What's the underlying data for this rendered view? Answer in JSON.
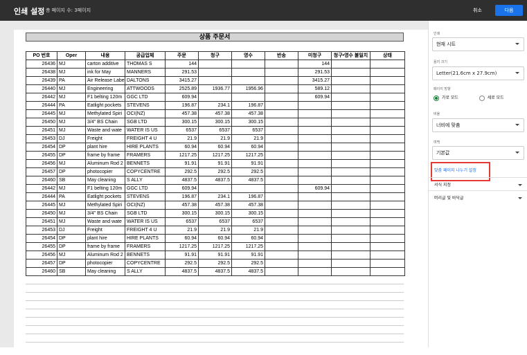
{
  "topbar": {
    "title": "인쇄 설정",
    "pages": "총 페이지 수: 3페이지",
    "cancel": "취소",
    "next": "다음"
  },
  "sheet": {
    "title": "상품 주문서",
    "headers": [
      "PO 번호",
      "Oper",
      "내용",
      "공급업체",
      "주문",
      "청구",
      "영수",
      "반송",
      "미청구",
      "청구•영수 불일치",
      "상태"
    ],
    "rows": [
      [
        "26436",
        "MJ",
        "carton additive",
        "THOMAS S",
        "144",
        "",
        "",
        "",
        "144",
        "",
        ""
      ],
      [
        "26438",
        "MJ",
        "ink for May",
        "MANNERS",
        "291.53",
        "",
        "",
        "",
        "291.53",
        "",
        ""
      ],
      [
        "26439",
        "PA",
        "Air Release Labe",
        "DALTONS",
        "3415.27",
        "",
        "",
        "",
        "3415.27",
        "",
        ""
      ],
      [
        "26440",
        "MJ",
        "Engineering",
        "ATTWOODS",
        "2525.89",
        "1936.77",
        "1956.96",
        "",
        "589.12",
        "",
        ""
      ],
      [
        "26442",
        "MJ",
        "F1 belting 120m",
        "GGC LTD",
        "609.94",
        "",
        "",
        "",
        "609.94",
        "",
        ""
      ],
      [
        "26444",
        "PA",
        "Eatlight pockets",
        "STEVENS",
        "196.87",
        "234.1",
        "196.87",
        "",
        "",
        "",
        ""
      ],
      [
        "26445",
        "MJ",
        "Methylated Spiri",
        "OCI(NZ)",
        "457.38",
        "457.38",
        "457.38",
        "",
        "",
        "",
        ""
      ],
      [
        "26450",
        "MJ",
        "3/4\" BS Chain",
        "SGB LTD",
        "300.15",
        "300.15",
        "300.15",
        "",
        "",
        "",
        ""
      ],
      [
        "26451",
        "MJ",
        "Waste and wate",
        "WATER IS US",
        "6537",
        "6537",
        "6537",
        "",
        "",
        "",
        ""
      ],
      [
        "26453",
        "DJ",
        "Freight",
        "FREIGHT 4 U",
        "21.9",
        "21.9",
        "21.9",
        "",
        "",
        "",
        ""
      ],
      [
        "26454",
        "DP",
        "plant hire",
        "HIRE PLANTS",
        "60.94",
        "60.94",
        "60.94",
        "",
        "",
        "",
        ""
      ],
      [
        "26455",
        "DP",
        "frame by frame",
        "FRAMERS",
        "1217.25",
        "1217.25",
        "1217.25",
        "",
        "",
        "",
        ""
      ],
      [
        "26456",
        "MJ",
        "Aluminum Rod 2",
        "BENNETS",
        "91.91",
        "91.91",
        "91.91",
        "",
        "",
        "",
        ""
      ],
      [
        "26457",
        "DP",
        "photocopier",
        "COPYCENTRE",
        "292.5",
        "292.5",
        "292.5",
        "",
        "",
        "",
        ""
      ],
      [
        "26460",
        "SB",
        "May cleaning",
        "S ALLY",
        "4837.5",
        "4837.5",
        "4837.5",
        "",
        "",
        "",
        ""
      ],
      [
        "26442",
        "MJ",
        "F1 belting 120m",
        "GGC LTD",
        "609.94",
        "",
        "",
        "",
        "609.94",
        "",
        ""
      ],
      [
        "26444",
        "PA",
        "Eatlight pockets",
        "STEVENS",
        "196.87",
        "234.1",
        "196.87",
        "",
        "",
        "",
        ""
      ],
      [
        "26445",
        "MJ",
        "Methylated Spiri",
        "OCI(NZ)",
        "457.38",
        "457.38",
        "457.38",
        "",
        "",
        "",
        ""
      ],
      [
        "26450",
        "MJ",
        "3/4\" BS Chain",
        "SGB LTD",
        "300.15",
        "300.15",
        "300.15",
        "",
        "",
        "",
        ""
      ],
      [
        "26451",
        "MJ",
        "Waste and wate",
        "WATER IS US",
        "6537",
        "6537",
        "6537",
        "",
        "",
        "",
        ""
      ],
      [
        "26453",
        "DJ",
        "Freight",
        "FREIGHT 4 U",
        "21.9",
        "21.9",
        "21.9",
        "",
        "",
        "",
        ""
      ],
      [
        "26454",
        "DP",
        "plant hire",
        "HIRE PLANTS",
        "60.94",
        "60.94",
        "60.94",
        "",
        "",
        "",
        ""
      ],
      [
        "26455",
        "DP",
        "frame by frame",
        "FRAMERS",
        "1217.25",
        "1217.25",
        "1217.25",
        "",
        "",
        "",
        ""
      ],
      [
        "26456",
        "MJ",
        "Aluminum Rod 2",
        "BENNETS",
        "91.91",
        "91.91",
        "91.91",
        "",
        "",
        "",
        ""
      ],
      [
        "26457",
        "DP",
        "photocopier",
        "COPYCENTRE",
        "292.5",
        "292.5",
        "292.5",
        "",
        "",
        "",
        ""
      ],
      [
        "26460",
        "SB",
        "May cleaning",
        "S ALLY",
        "4837.5",
        "4837.5",
        "4837.5",
        "",
        "",
        "",
        ""
      ]
    ]
  },
  "panel": {
    "print_label": "인쇄",
    "print_value": "현재 시트",
    "paper_label": "용지 크기",
    "paper_value": "Letter(21.6cm x 27.9cm)",
    "orientation_label": "페이지 방향",
    "landscape": "가로 모드",
    "portrait": "세로 모드",
    "scale_label": "비율",
    "scale_value": "너비에 맞춤",
    "margin_label": "여백",
    "margin_value": "기본값",
    "custom_breaks": "맞춤 페이지 나누기 설정",
    "format_section": "서식 지정",
    "header_section": "머리글 및 바닥글"
  },
  "colors": {
    "topbar": "#2f2f2f",
    "accent": "#1a73e8",
    "highlight": "#e53935",
    "radio": "#188038"
  }
}
